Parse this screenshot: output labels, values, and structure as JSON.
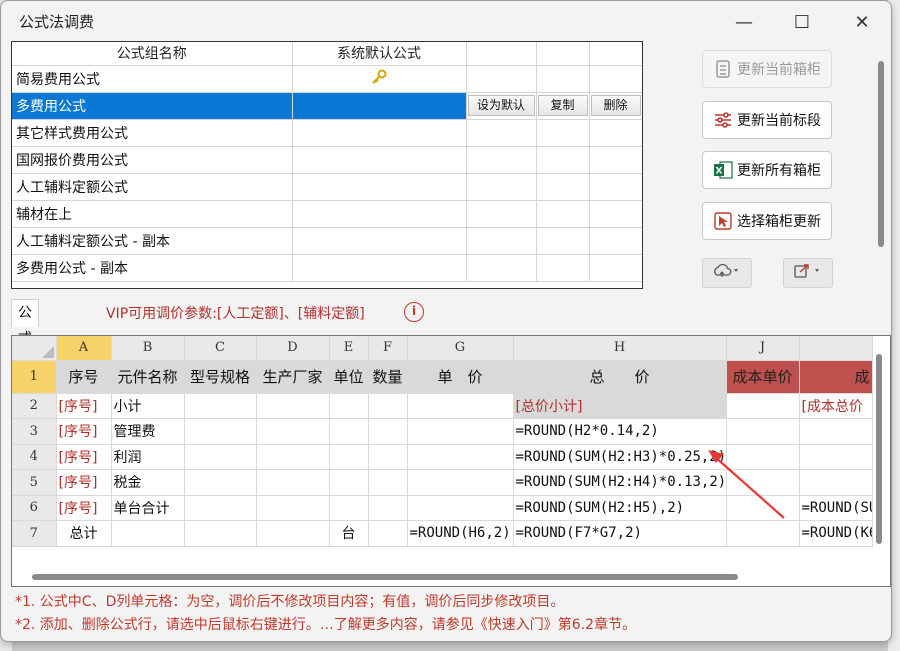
{
  "window": {
    "title": "公式法调费",
    "minimize": "—",
    "maximize": "☐",
    "close": "✕"
  },
  "formula_groups": {
    "headers": [
      "公式组名称",
      "系统默认公式"
    ],
    "rows": [
      {
        "name": "简易费用公式",
        "is_default": true
      },
      {
        "name": "多费用公式",
        "selected": true
      },
      {
        "name": "其它样式费用公式"
      },
      {
        "name": "国网报价费用公式"
      },
      {
        "name": "人工辅料定额公式"
      },
      {
        "name": "辅材在上"
      },
      {
        "name": "人工辅料定额公式 - 副本"
      },
      {
        "name": "多费用公式 - 副本"
      }
    ],
    "row_actions": {
      "set_default": "设为默认",
      "copy": "复制",
      "delete": "删除"
    }
  },
  "right_buttons": [
    {
      "label": "更新当前箱柜",
      "icon": "cabinet-icon",
      "disabled": true
    },
    {
      "label": "更新当前标段",
      "icon": "sliders-icon"
    },
    {
      "label": "更新所有箱柜",
      "icon": "excel-icon"
    },
    {
      "label": "选择箱柜更新",
      "icon": "cursor-select-icon"
    }
  ],
  "detail": {
    "tab_label": "公式组明细",
    "vip_note": "VIP可用调价参数:[人工定额]、[辅料定额]",
    "info_icon": "i"
  },
  "sheet": {
    "col_letters": [
      "A",
      "B",
      "C",
      "D",
      "E",
      "F",
      "G",
      "H",
      "J",
      ""
    ],
    "row_numbers": [
      "1",
      "2",
      "3",
      "4",
      "5",
      "6",
      "7"
    ],
    "header_row": [
      "序号",
      "元件名称",
      "型号规格",
      "生产厂家",
      "单位",
      "数量",
      "单　价",
      "总　　价",
      "成本单价",
      "成"
    ],
    "rows": [
      {
        "a": "[序号]",
        "b": "小计",
        "h": "[总价小计]",
        "k": "[成本总价"
      },
      {
        "a": "[序号]",
        "b": "管理费",
        "h": "=ROUND(H2*0.14,2)"
      },
      {
        "a": "[序号]",
        "b": "利润",
        "h": "=ROUND(SUM(H2:H3)*0.25,2)"
      },
      {
        "a": "[序号]",
        "b": "税金",
        "h": "=ROUND(SUM(H2:H4)*0.13,2)"
      },
      {
        "a": "[序号]",
        "b": "单台合计",
        "h": "=ROUND(SUM(H2:H5),2)",
        "k": "=ROUND(SU"
      },
      {
        "a": "总计",
        "b": "",
        "e": "台",
        "g": "=ROUND(H6,2)",
        "h": "=ROUND(F7*G7,2)",
        "k": "=ROUND(K6"
      }
    ]
  },
  "notes": [
    "*1. 公式中C、D列单元格：为空，调价后不修改项目内容；有值，调价后同步修改项目。",
    "*2. 添加、删除公式行，请选中后鼠标右键进行。…了解更多内容，请参见《快速入门》第6.2章节。"
  ],
  "colors": {
    "selection": "#0a78d4",
    "cost_header": "#c0504d",
    "accent_red": "#b0302c"
  }
}
